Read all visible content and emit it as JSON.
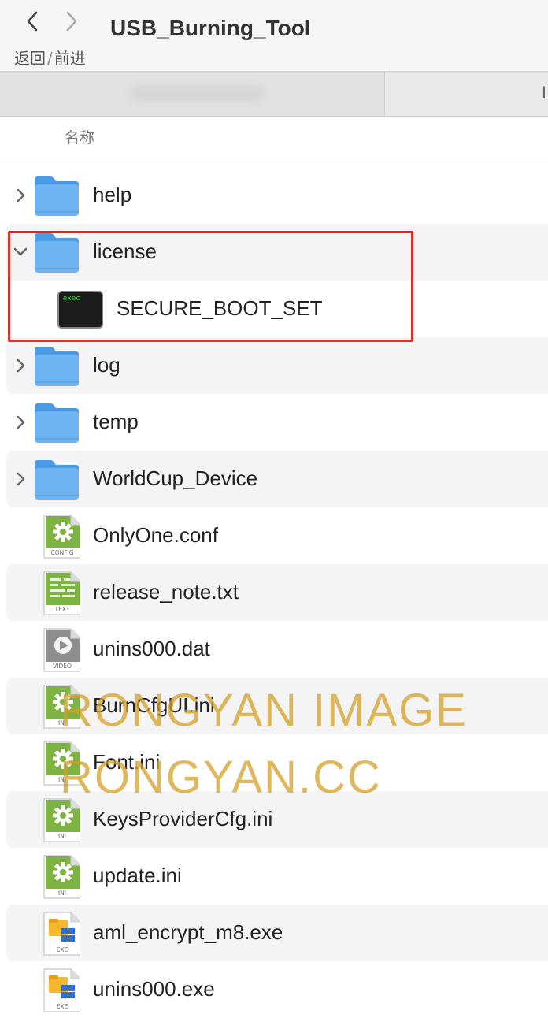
{
  "toolbar": {
    "nav_back_label": "返回",
    "nav_separator": "/",
    "nav_forward_label": "前进",
    "window_title": "USB_Burning_Tool"
  },
  "tabbar": {
    "second_tab_text": "I"
  },
  "column_header": {
    "name": "名称"
  },
  "files": [
    {
      "name": "help",
      "type": "folder",
      "expanded": false
    },
    {
      "name": "license",
      "type": "folder",
      "expanded": true
    },
    {
      "name": "SECURE_BOOT_SET",
      "type": "exec",
      "badge": "exec",
      "child": true
    },
    {
      "name": "log",
      "type": "folder",
      "expanded": false
    },
    {
      "name": "temp",
      "type": "folder",
      "expanded": false
    },
    {
      "name": "WorldCup_Device",
      "type": "folder",
      "expanded": false
    },
    {
      "name": "OnlyOne.conf",
      "type": "config",
      "badge": "CONFIG"
    },
    {
      "name": "release_note.txt",
      "type": "text",
      "badge": "TEXT"
    },
    {
      "name": "unins000.dat",
      "type": "video",
      "badge": "VIDEO"
    },
    {
      "name": "BurnCfgUI.ini",
      "type": "ini",
      "badge": "INI"
    },
    {
      "name": "Font.ini",
      "type": "ini",
      "badge": "INI"
    },
    {
      "name": "KeysProviderCfg.ini",
      "type": "ini",
      "badge": "INI"
    },
    {
      "name": "update.ini",
      "type": "ini",
      "badge": "INI"
    },
    {
      "name": "aml_encrypt_m8.exe",
      "type": "exe",
      "badge": "EXE"
    },
    {
      "name": "unins000.exe",
      "type": "exe",
      "badge": "EXE"
    }
  ],
  "watermark": {
    "line1": "RONGYAN IMAGE",
    "line2": "RONGYAN.CC"
  },
  "colors": {
    "highlight_border": "#d8302a",
    "folder_blue": "#6db3f2",
    "config_green": "#7cb342"
  }
}
